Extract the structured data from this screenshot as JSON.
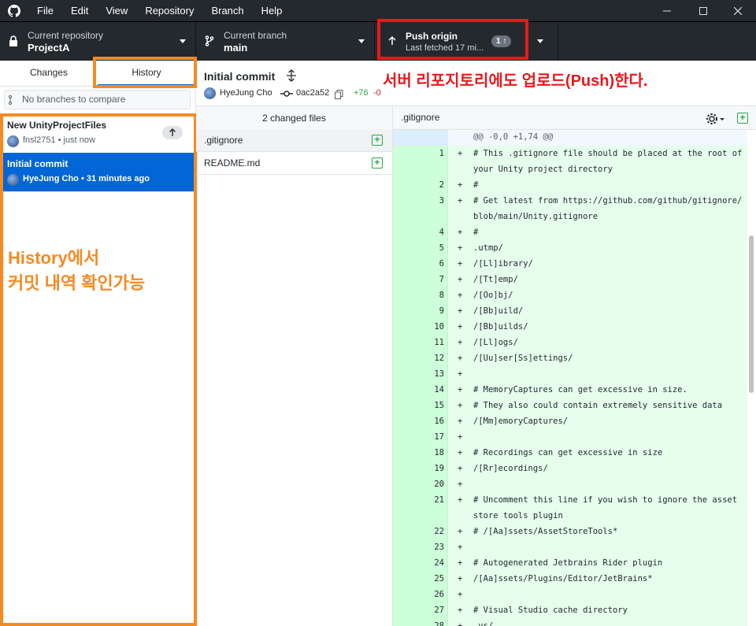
{
  "menu": {
    "items": [
      "File",
      "Edit",
      "View",
      "Repository",
      "Branch",
      "Help"
    ]
  },
  "toolbar": {
    "repo_label": "Current repository",
    "repo_value": "ProjectA",
    "branch_label": "Current branch",
    "branch_value": "main",
    "push_label": "Push origin",
    "push_sub": "Last fetched 17 mi...",
    "push_badge": "1 ↑"
  },
  "tabs": {
    "changes": "Changes",
    "history": "History"
  },
  "filter_placeholder": "No branches to compare",
  "commits": [
    {
      "title": "New UnityProjectFiles",
      "meta": "fnsl2751 • just now"
    },
    {
      "title": "Initial commit",
      "meta": "HyeJung Cho • 31 minutes ago"
    }
  ],
  "annotation_left": [
    "History에서",
    "커밋 내역 확인가능"
  ],
  "annotation_top": "서버 리포지토리에도 업로드(Push)한다.",
  "commit_header": {
    "title": "Initial commit",
    "author": "HyeJung Cho",
    "sha": "0ac2a52",
    "added": "+76",
    "removed": "-0"
  },
  "changed_files_label": "2 changed files",
  "files": [
    ".gitignore",
    "README.md"
  ],
  "diff": {
    "filename": ".gitignore",
    "hunk": "@@ -0,0 +1,74 @@",
    "lines": [
      {
        "n": "1",
        "t": "# This .gitignore file should be placed at the root of your Unity project directory",
        "h": 2
      },
      {
        "n": "2",
        "t": "#",
        "h": 1
      },
      {
        "n": "3",
        "t": "# Get latest from https://github.com/github/gitignore/blob/main/Unity.gitignore",
        "h": 2
      },
      {
        "n": "4",
        "t": "#",
        "h": 1
      },
      {
        "n": "5",
        "t": ".utmp/",
        "h": 1
      },
      {
        "n": "6",
        "t": "/[Ll]ibrary/",
        "h": 1
      },
      {
        "n": "7",
        "t": "/[Tt]emp/",
        "h": 1
      },
      {
        "n": "8",
        "t": "/[Oo]bj/",
        "h": 1
      },
      {
        "n": "9",
        "t": "/[Bb]uild/",
        "h": 1
      },
      {
        "n": "10",
        "t": "/[Bb]uilds/",
        "h": 1
      },
      {
        "n": "11",
        "t": "/[Ll]ogs/",
        "h": 1
      },
      {
        "n": "12",
        "t": "/[Uu]ser[Ss]ettings/",
        "h": 1
      },
      {
        "n": "13",
        "t": "",
        "h": 1
      },
      {
        "n": "14",
        "t": "# MemoryCaptures can get excessive in size.",
        "h": 1
      },
      {
        "n": "15",
        "t": "# They also could contain extremely sensitive data",
        "h": 1
      },
      {
        "n": "16",
        "t": "/[Mm]emoryCaptures/",
        "h": 1
      },
      {
        "n": "17",
        "t": "",
        "h": 1
      },
      {
        "n": "18",
        "t": "# Recordings can get excessive in size",
        "h": 1
      },
      {
        "n": "19",
        "t": "/[Rr]ecordings/",
        "h": 1
      },
      {
        "n": "20",
        "t": "",
        "h": 1
      },
      {
        "n": "21",
        "t": "# Uncomment this line if you wish to ignore the asset store tools plugin",
        "h": 2
      },
      {
        "n": "22",
        "t": "# /[Aa]ssets/AssetStoreTools*",
        "h": 1
      },
      {
        "n": "23",
        "t": "",
        "h": 1
      },
      {
        "n": "24",
        "t": "# Autogenerated Jetbrains Rider plugin",
        "h": 1
      },
      {
        "n": "25",
        "t": "/[Aa]ssets/Plugins/Editor/JetBrains*",
        "h": 1
      },
      {
        "n": "26",
        "t": "",
        "h": 1
      },
      {
        "n": "27",
        "t": "# Visual Studio cache directory",
        "h": 1
      },
      {
        "n": "28",
        "t": ".vs/",
        "h": 1
      }
    ]
  }
}
